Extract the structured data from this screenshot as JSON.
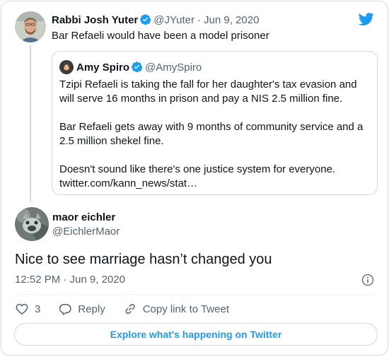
{
  "colors": {
    "accent": "#1d9bf0",
    "text": "#0f1419",
    "muted": "#536471",
    "border": "#cfd9de"
  },
  "parent_tweet": {
    "author_name": "Rabbi Josh Yuter",
    "author_handle": "@JYuter",
    "separator": "·",
    "date": "Jun 9, 2020",
    "text": "Bar Refaeli would have been a model prisoner"
  },
  "quoted_tweet": {
    "author_name": "Amy Spiro",
    "author_handle": "@AmySpiro",
    "paragraphs": [
      "Tzipi Refaeli is taking the fall for her daughter's tax evasion and will serve 16 months in prison and pay a NIS 2.5 million fine.",
      "Bar Refaeli gets away with 9 months of community service and a 2.5 million shekel fine.",
      "Doesn't sound like there's one justice system for everyone. twitter.com/kann_news/stat…"
    ]
  },
  "reply_tweet": {
    "author_name": "maor eichler",
    "author_handle": "@EichlerMaor",
    "text": "Nice to see marriage hasn’t changed you",
    "timestamp": "12:52 PM · Jun 9, 2020"
  },
  "actions": {
    "like_count": "3",
    "reply_label": "Reply",
    "copy_link_label": "Copy link to Tweet"
  },
  "footer": {
    "explore_label": "Explore what's happening on Twitter"
  },
  "icons": [
    "twitter-bird-icon",
    "verified-badge-icon",
    "info-icon",
    "heart-icon",
    "reply-bubble-icon",
    "link-icon"
  ]
}
